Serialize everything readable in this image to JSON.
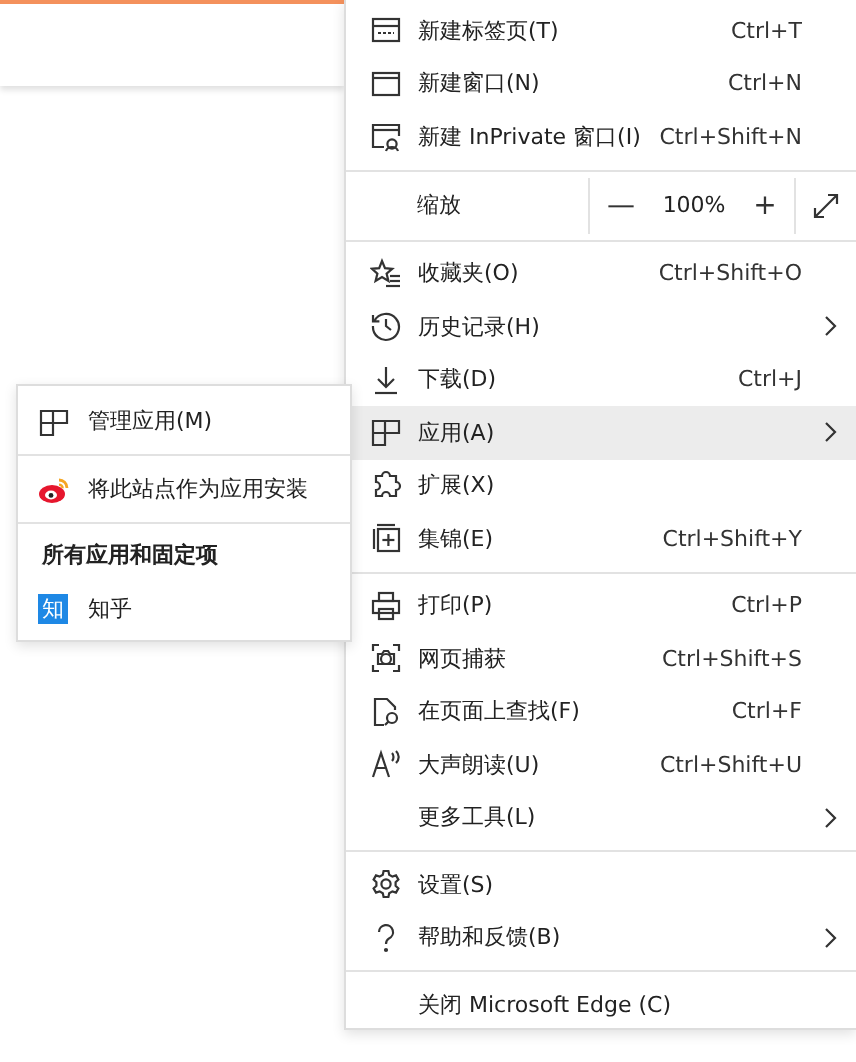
{
  "main_menu": {
    "items": [
      {
        "kind": "item",
        "label": "新建标签页(T)",
        "shortcut": "Ctrl+T",
        "submenu": false,
        "selected": false
      },
      {
        "kind": "item",
        "label": "新建窗口(N)",
        "shortcut": "Ctrl+N",
        "submenu": false,
        "selected": false
      },
      {
        "kind": "item",
        "label": "新建 InPrivate 窗口(I)",
        "shortcut": "Ctrl+Shift+N",
        "submenu": false,
        "selected": false
      },
      {
        "kind": "separator"
      },
      {
        "kind": "zoom",
        "label": "缩放",
        "minus": "—",
        "value": "100%",
        "plus": "+"
      },
      {
        "kind": "separator"
      },
      {
        "kind": "item",
        "label": "收藏夹(O)",
        "shortcut": "Ctrl+Shift+O",
        "submenu": false,
        "selected": false
      },
      {
        "kind": "item",
        "label": "历史记录(H)",
        "submenu": true,
        "selected": false
      },
      {
        "kind": "item",
        "label": "下载(D)",
        "shortcut": "Ctrl+J",
        "submenu": false,
        "selected": false
      },
      {
        "kind": "item",
        "label": "应用(A)",
        "submenu": true,
        "selected": true
      },
      {
        "kind": "item",
        "label": "扩展(X)",
        "submenu": false,
        "selected": false
      },
      {
        "kind": "item",
        "label": "集锦(E)",
        "shortcut": "Ctrl+Shift+Y",
        "submenu": false,
        "selected": false
      },
      {
        "kind": "separator"
      },
      {
        "kind": "item",
        "label": "打印(P)",
        "shortcut": "Ctrl+P",
        "submenu": false,
        "selected": false
      },
      {
        "kind": "item",
        "label": "网页捕获",
        "shortcut": "Ctrl+Shift+S",
        "submenu": false,
        "selected": false
      },
      {
        "kind": "item",
        "label": "在页面上查找(F)",
        "shortcut": "Ctrl+F",
        "submenu": false,
        "selected": false
      },
      {
        "kind": "item",
        "label": "大声朗读(U)",
        "shortcut": "Ctrl+Shift+U",
        "submenu": false,
        "selected": false
      },
      {
        "kind": "item",
        "label": "更多工具(L)",
        "submenu": true,
        "selected": false
      },
      {
        "kind": "separator"
      },
      {
        "kind": "item",
        "label": "设置(S)",
        "submenu": false,
        "selected": false
      },
      {
        "kind": "item",
        "label": "帮助和反馈(B)",
        "submenu": true,
        "selected": false
      },
      {
        "kind": "separator"
      },
      {
        "kind": "item",
        "label": "关闭 Microsoft Edge (C)",
        "submenu": false,
        "selected": false
      }
    ]
  },
  "apps_submenu": {
    "items": [
      {
        "kind": "item",
        "label": "管理应用(M)"
      },
      {
        "kind": "separator"
      },
      {
        "kind": "item",
        "label": "将此站点作为应用安装"
      },
      {
        "kind": "separator"
      },
      {
        "kind": "header",
        "label": "所有应用和固定项"
      },
      {
        "kind": "app",
        "label": "知乎",
        "badge": "知"
      }
    ]
  }
}
